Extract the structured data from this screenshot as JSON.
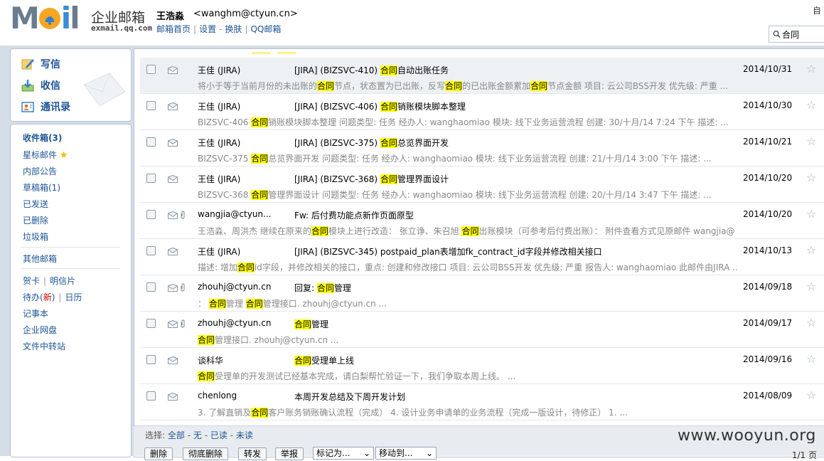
{
  "header": {
    "logo_text": "企业邮箱",
    "logo_domain": "exmail.qq.com",
    "user_name": "王浩淼",
    "user_email": "<wanghm@ctyun.cn>",
    "links": [
      "邮箱首页",
      "设置",
      "换肤",
      "QQ邮箱"
    ],
    "corner_text": "自",
    "search_value": "合同"
  },
  "compose": {
    "write": "写信",
    "receive": "收信",
    "contacts": "通讯录"
  },
  "folders": {
    "inbox": "收件箱(3)",
    "starred": "星标邮件",
    "internal": "内部公告",
    "drafts": "草稿箱(1)",
    "sent": "已发送",
    "deleted": "已删除",
    "spam": "垃圾箱",
    "other": "其他邮箱",
    "cards": "贺卡",
    "postcards": "明信片",
    "todo": "待办(",
    "todo_new": "新",
    "todo_end": ")",
    "calendar": "日历",
    "notes": "记事本",
    "netdisk": "企业网盘",
    "transfer": "文件中转站"
  },
  "mails": [
    {
      "sender": "王佳 (JIRA)",
      "subject": [
        "[JIRA] (BIZSVC-410) ",
        "合同",
        "自动出账任务"
      ],
      "date": "2014/10/31",
      "preview": [
        "将小于等于当前月份的未出账的",
        "合同",
        "节点，状态置为已出账，反写",
        "合同",
        "的已出账金额累加",
        "合同",
        "节点金额 项目: 云公司BSS开发 优先级: 严重 ..."
      ],
      "attachment": false
    },
    {
      "sender": "王佳 (JIRA)",
      "subject": [
        "[JIRA] (BIZSVC-406) ",
        "合同",
        "销账模块脚本整理"
      ],
      "date": "2014/10/30",
      "preview": [
        "BIZSVC-406 ",
        "合同",
        "销账模块脚本整理 问题类型: 任务 经办人: wanghaomiao 模块: 线下业务运营流程 创建: 30/十月/14 7:24 下午 描述: ..."
      ],
      "attachment": false
    },
    {
      "sender": "王佳 (JIRA)",
      "subject": [
        "[JIRA] (BIZSVC-375) ",
        "合同",
        "总览界面开发"
      ],
      "date": "2014/10/21",
      "preview": [
        "BIZSVC-375 ",
        "合同",
        "总览界面开发 问题类型: 任务 经办人: wanghaomiao 模块: 线下业务运营流程 创建: 21/十月/14 3:00 下午 描述: ..."
      ],
      "attachment": false
    },
    {
      "sender": "王佳 (JIRA)",
      "subject": [
        "[JIRA] (BIZSVC-368) ",
        "合同",
        "管理界面设计"
      ],
      "date": "2014/10/20",
      "preview": [
        "BIZSVC-368 ",
        "合同",
        "管理界面设计 问题类型: 任务 经办人: wanghaomiao 模块: 线下业务运营流程 创建: 20/十月/14 3:47 下午 描述: ..."
      ],
      "attachment": false
    },
    {
      "sender": "wangjia@ctyun...",
      "subject": [
        "Fw: 后付费功能点新作页面原型",
        "",
        ""
      ],
      "date": "2014/10/20",
      "preview": [
        "王浩淼、周洪杰 继续在原来的",
        "合同",
        "模块上进行改造： 张立诤、朱召旭 ",
        "合同",
        "出账模块（可参考后付费出账）： 附件查看方式见原邮件 wangjia@ ..."
      ],
      "attachment": true
    },
    {
      "sender": "王佳 (JIRA)",
      "subject": [
        "[JIRA] (BIZSVC-345) postpaid_plan表增加fk_contract_id字段并修改相关接口",
        "",
        ""
      ],
      "date": "2014/10/13",
      "preview": [
        "描述: 增加",
        "合同",
        "id字段，并修改相关的接口，重点: 创建和修改接口 项目: 云公司BSS开发 优先级: 严重 报告人: wanghaomiao 此邮件由JIRA ..."
      ],
      "attachment": false
    },
    {
      "sender": "zhouhj@ctyun.cn",
      "subject": [
        "回复: ",
        "合同",
        "管理"
      ],
      "date": "2014/09/18",
      "preview": [
        "：  ",
        "合同",
        "管理 ",
        "合同",
        "管理接口. zhouhj@ctyun.cn ..."
      ],
      "attachment": true
    },
    {
      "sender": "zhouhj@ctyun.cn",
      "subject": [
        "",
        "合同",
        "管理"
      ],
      "date": "2014/09/17",
      "preview": [
        "",
        "合同",
        "管理接口. zhouhj@ctyun.cn ..."
      ],
      "attachment": true
    },
    {
      "sender": "谈科华",
      "subject": [
        "",
        "合同",
        "受理单上线"
      ],
      "date": "2014/09/16",
      "preview": [
        "",
        "合同",
        "受理单的开发测试已经基本完成，请白梨帮忙验证一下，我们争取本周上线。 ..."
      ],
      "attachment": false
    },
    {
      "sender": "chenlong",
      "subject": [
        "本周开发总结及下周开发计划",
        "",
        ""
      ],
      "date": "2014/08/09",
      "preview": [
        "3. 了解直销及",
        "合同",
        "客户账务销账确认流程（完成） 4. 设计业务申请单的业务流程（完成一版设计，待修正） 1. ..."
      ],
      "attachment": false
    }
  ],
  "select_bar": {
    "label": "选择:",
    "all": "全部",
    "none": "无",
    "read": "已读",
    "unread": "未读"
  },
  "actions": {
    "delete": "删除",
    "purge": "彻底删除",
    "forward": "转发",
    "report": "举报",
    "mark_as": "标记为...",
    "move_to": "移动到...",
    "page": "1/1 页"
  },
  "watermark": "www.wooyun.org"
}
